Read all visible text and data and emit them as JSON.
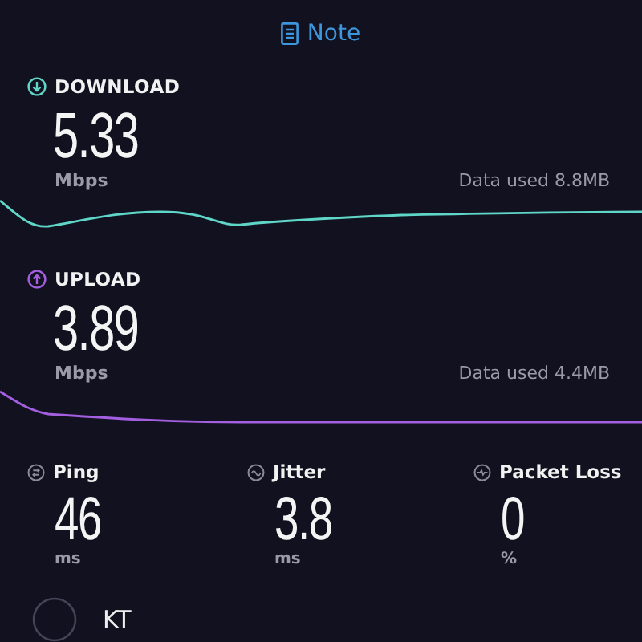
{
  "header": {
    "link": "Note"
  },
  "speeds": [
    {
      "kind": "download",
      "label": "DOWNLOAD",
      "value": "5.33",
      "unit": "Mbps",
      "data_used": "Data used 8.8MB",
      "color": "#5fd6c8"
    },
    {
      "kind": "upload",
      "label": "UPLOAD",
      "value": "3.89",
      "unit": "Mbps",
      "data_used": "Data used 4.4MB",
      "color": "#a45fe0"
    }
  ],
  "stats": [
    {
      "kind": "ping",
      "label": "Ping",
      "value": "46",
      "unit": "ms"
    },
    {
      "kind": "jitter",
      "label": "Jitter",
      "value": "3.8",
      "unit": "ms"
    },
    {
      "kind": "loss",
      "label": "Packet Loss",
      "value": "0",
      "unit": "%"
    }
  ],
  "provider": {
    "name": "KT"
  }
}
